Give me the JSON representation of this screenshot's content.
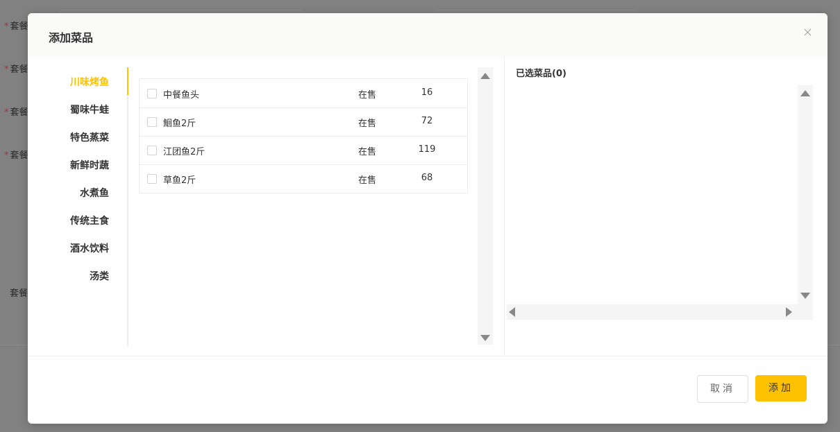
{
  "background": {
    "labels": [
      "套餐",
      "套餐",
      "套餐",
      "套餐",
      "套餐"
    ]
  },
  "dialog": {
    "title": "添加菜品",
    "close_icon": "close-icon"
  },
  "categories": [
    {
      "label": "川味烤鱼",
      "active": true
    },
    {
      "label": "蜀味牛蛙",
      "active": false
    },
    {
      "label": "特色蒸菜",
      "active": false
    },
    {
      "label": "新鲜时蔬",
      "active": false
    },
    {
      "label": "水煮鱼",
      "active": false
    },
    {
      "label": "传统主食",
      "active": false
    },
    {
      "label": "酒水饮料",
      "active": false
    },
    {
      "label": "汤类",
      "active": false
    }
  ],
  "dishes": [
    {
      "name": "中餐鱼头",
      "status": "在售",
      "price": "16",
      "checked": false
    },
    {
      "name": "鮰鱼2斤",
      "status": "在售",
      "price": "72",
      "checked": false
    },
    {
      "name": "江团鱼2斤",
      "status": "在售",
      "price": "119",
      "checked": false
    },
    {
      "name": "草鱼2斤",
      "status": "在售",
      "price": "68",
      "checked": false
    }
  ],
  "selected_panel": {
    "title": "已选菜品(0)"
  },
  "footer": {
    "cancel_label": "取消",
    "add_label": "添加"
  },
  "colors": {
    "accent": "#ffc200",
    "overlay": "#7f7f7f",
    "header_bg": "#fafaf8"
  }
}
